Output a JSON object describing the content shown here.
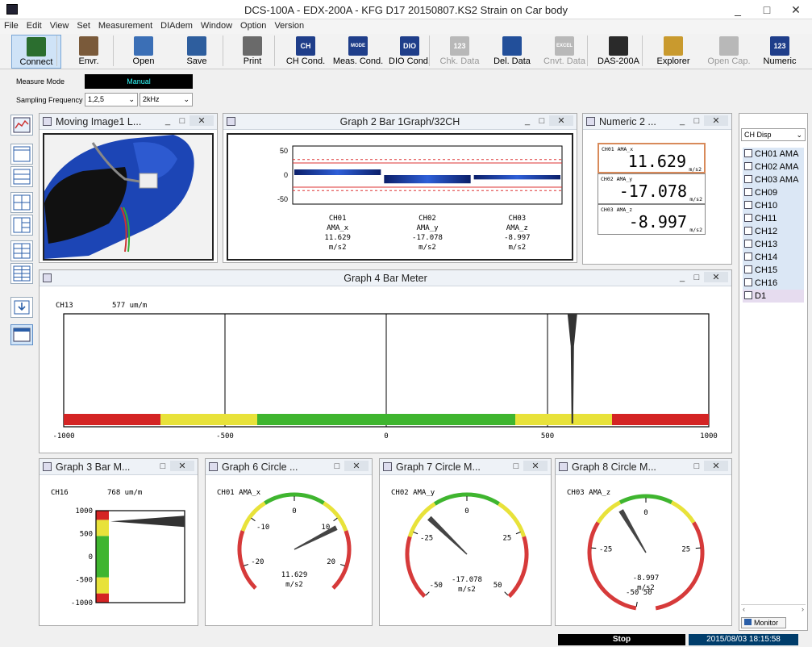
{
  "app": {
    "title": "DCS-100A - EDX-200A - KFG D17 20150807.KS2 Strain on Car body"
  },
  "menu": [
    "File",
    "Edit",
    "View",
    "Set",
    "Measurement",
    "DIAdem",
    "Window",
    "Option",
    "Version"
  ],
  "toolbar": [
    {
      "label": "Connect",
      "icon": "connect-icon",
      "color": "#2b6e2f",
      "active": true,
      "enabled": true
    },
    {
      "label": "Envr.",
      "icon": "environment-icon",
      "color": "#7a5a3a",
      "active": false,
      "enabled": true
    },
    {
      "label": "Open",
      "icon": "open-icon",
      "color": "#3b6fb6",
      "active": false,
      "enabled": true
    },
    {
      "label": "Save",
      "icon": "save-icon",
      "color": "#2e5e9e",
      "active": false,
      "enabled": true
    },
    {
      "label": "Print",
      "icon": "print-icon",
      "color": "#6a6a6a",
      "active": false,
      "enabled": true
    },
    {
      "label": "CH Cond.",
      "icon": "ch-cond-icon",
      "color": "#1f3e8a",
      "active": false,
      "enabled": true
    },
    {
      "label": "Meas. Cond.",
      "icon": "meas-cond-icon",
      "color": "#1f3e8a",
      "active": false,
      "enabled": true
    },
    {
      "label": "DIO Cond.",
      "icon": "dio-cond-icon",
      "color": "#1f3e8a",
      "active": false,
      "enabled": true
    },
    {
      "label": "Chk. Data",
      "icon": "check-data-icon",
      "color": "#b8b8b8",
      "active": false,
      "enabled": false
    },
    {
      "label": "Del. Data",
      "icon": "delete-data-icon",
      "color": "#224f9a",
      "active": false,
      "enabled": true
    },
    {
      "label": "Cnvt. Data",
      "icon": "convert-data-icon",
      "color": "#b8b8b8",
      "active": false,
      "enabled": false
    },
    {
      "label": "DAS-200A",
      "icon": "das-200a-icon",
      "color": "#2a2a2a",
      "active": false,
      "enabled": true
    },
    {
      "label": "Explorer",
      "icon": "explorer-icon",
      "color": "#c99a2e",
      "active": false,
      "enabled": true
    },
    {
      "label": "Open Cap.",
      "icon": "open-capture-icon",
      "color": "#b8b8b8",
      "active": false,
      "enabled": false
    },
    {
      "label": "Numeric",
      "icon": "numeric-icon",
      "color": "#1f3e8a",
      "active": false,
      "enabled": true
    }
  ],
  "toolbar_icon_text": {
    "ch": "CH",
    "dio": "DIO",
    "numeric": "123",
    "mode": "MODE",
    "excel": "EXCEL",
    "chk": "123"
  },
  "controls": {
    "measure_mode_label": "Measure Mode",
    "measure_mode_value": "Manual",
    "sampling_label": "Sampling Frequency",
    "sampling_channels": "1,2,5",
    "sampling_rate": "2kHz",
    "dropdown_arrow": "⌄"
  },
  "win_buttons": {
    "min": "_",
    "max": "□",
    "close": "✕"
  },
  "windows": {
    "moving_image": {
      "title": "Moving Image1 L..."
    },
    "graph2": {
      "title": "Graph 2 Bar 1Graph/32CH"
    },
    "numeric2": {
      "title": "Numeric 2 ..."
    },
    "graph4": {
      "title": "Graph 4 Bar Meter"
    },
    "graph3": {
      "title": "Graph 3 Bar M..."
    },
    "graph6": {
      "title": "Graph 6 Circle ..."
    },
    "graph7": {
      "title": "Graph 7 Circle M..."
    },
    "graph8": {
      "title": "Graph 8 Circle M..."
    }
  },
  "numeric": [
    {
      "label": "CH01 AMA_x",
      "value": "11.629",
      "unit": "m/s2"
    },
    {
      "label": "CH02 AMA_y",
      "value": "-17.078",
      "unit": "m/s2"
    },
    {
      "label": "CH03 AMA_z",
      "value": "-8.997",
      "unit": "m/s2"
    }
  ],
  "right_panel": {
    "dropdown": "CH Disp",
    "items": [
      "CH01  AMA",
      "CH02  AMA",
      "CH03  AMA",
      "CH09",
      "CH10",
      "CH11",
      "CH12",
      "CH13",
      "CH14",
      "CH15",
      "CH16",
      "D1"
    ],
    "tab": "Monitor"
  },
  "status": {
    "state": "Stop",
    "datetime": "2015/08/03 18:15:58"
  },
  "colors": {
    "red": "#d42424",
    "yellow": "#e8e23a",
    "green": "#3fb52f",
    "gauge_red": "#d63a3a"
  },
  "chart_data": [
    {
      "type": "bar",
      "title": "Graph 2 Bar 1Graph/32CH",
      "ylim": [
        -50,
        50
      ],
      "yticks": [
        "50",
        "0",
        "-50"
      ],
      "categories": [
        "CH01",
        "CH02",
        "CH03"
      ],
      "series_names": [
        "AMA_x",
        "AMA_y",
        "AMA_z"
      ],
      "values": [
        11.629,
        -17.078,
        -8.997
      ],
      "value_labels": [
        "11.629",
        "-17.078",
        "-8.997"
      ],
      "unit": "m/s2"
    },
    {
      "type": "bar",
      "title": "Graph 4 Bar Meter",
      "channel": "CH13",
      "value_label": "577 um/m",
      "value": 577,
      "xlim": [
        -1000,
        1000
      ],
      "xticks": [
        "-1000",
        "-500",
        "0",
        "500",
        "1000"
      ],
      "zones": [
        {
          "from": -1000,
          "to": -700,
          "color": "red"
        },
        {
          "from": -700,
          "to": -400,
          "color": "yellow"
        },
        {
          "from": -400,
          "to": 400,
          "color": "green"
        },
        {
          "from": 400,
          "to": 700,
          "color": "yellow"
        },
        {
          "from": 700,
          "to": 1000,
          "color": "red"
        }
      ]
    },
    {
      "type": "bar",
      "title": "Graph 3 Bar M...",
      "channel": "CH16",
      "value_label": "768 um/m",
      "value": 768,
      "ylim": [
        -1000,
        1000
      ],
      "yticks": [
        "1000",
        "500",
        "0",
        "-500",
        "-1000"
      ],
      "zones": [
        {
          "from": -1000,
          "to": -800,
          "color": "red"
        },
        {
          "from": -800,
          "to": -450,
          "color": "yellow"
        },
        {
          "from": -450,
          "to": 450,
          "color": "green"
        },
        {
          "from": 450,
          "to": 800,
          "color": "yellow"
        },
        {
          "from": 800,
          "to": 1000,
          "color": "red"
        }
      ]
    },
    {
      "type": "gauge",
      "title": "Graph 6 Circle ...",
      "channel_label": "CH01 AMA_x",
      "min": -25,
      "max": 25,
      "ticks": [
        "-20",
        "-10",
        "0",
        "10",
        "20"
      ],
      "tick_values": [
        -20,
        -10,
        0,
        10,
        20
      ],
      "value": 11.629,
      "value_label": "11.629",
      "unit": "m/s2",
      "zones": [
        {
          "from": -25,
          "to": -13,
          "color": "red"
        },
        {
          "from": -13,
          "to": -6,
          "color": "yellow"
        },
        {
          "from": -6,
          "to": 6,
          "color": "green"
        },
        {
          "from": 6,
          "to": 13,
          "color": "yellow"
        },
        {
          "from": 13,
          "to": 25,
          "color": "red"
        }
      ]
    },
    {
      "type": "gauge",
      "title": "Graph 7 Circle M...",
      "channel_label": "CH02 AMA_y",
      "min": -50,
      "max": 50,
      "ticks": [
        "-50",
        "-25",
        "0",
        "25",
        "50"
      ],
      "tick_values": [
        -50,
        -25,
        0,
        25,
        50
      ],
      "value": -17.078,
      "value_label": "-17.078",
      "unit": "m/s2",
      "zones": [
        {
          "from": -50,
          "to": -27,
          "color": "red"
        },
        {
          "from": -27,
          "to": -12,
          "color": "yellow"
        },
        {
          "from": -12,
          "to": 12,
          "color": "green"
        },
        {
          "from": 12,
          "to": 27,
          "color": "yellow"
        },
        {
          "from": 27,
          "to": 50,
          "color": "red"
        }
      ]
    },
    {
      "type": "gauge",
      "title": "Graph 8 Circle M...",
      "channel_label": "CH03 AMA_z",
      "min": -50,
      "max": 50,
      "ticks": [
        "-50 50",
        "-25",
        "0",
        "25"
      ],
      "tick_values": [
        -50,
        -25,
        0,
        25
      ],
      "value": -8.997,
      "value_label": "-8.997",
      "unit": "m/s2",
      "full_circle": true,
      "zones": [
        {
          "from": -50,
          "to": -17,
          "color": "red"
        },
        {
          "from": -17,
          "to": -8,
          "color": "yellow"
        },
        {
          "from": -8,
          "to": 8,
          "color": "green"
        },
        {
          "from": 8,
          "to": 17,
          "color": "yellow"
        },
        {
          "from": 17,
          "to": 50,
          "color": "red"
        }
      ]
    }
  ]
}
